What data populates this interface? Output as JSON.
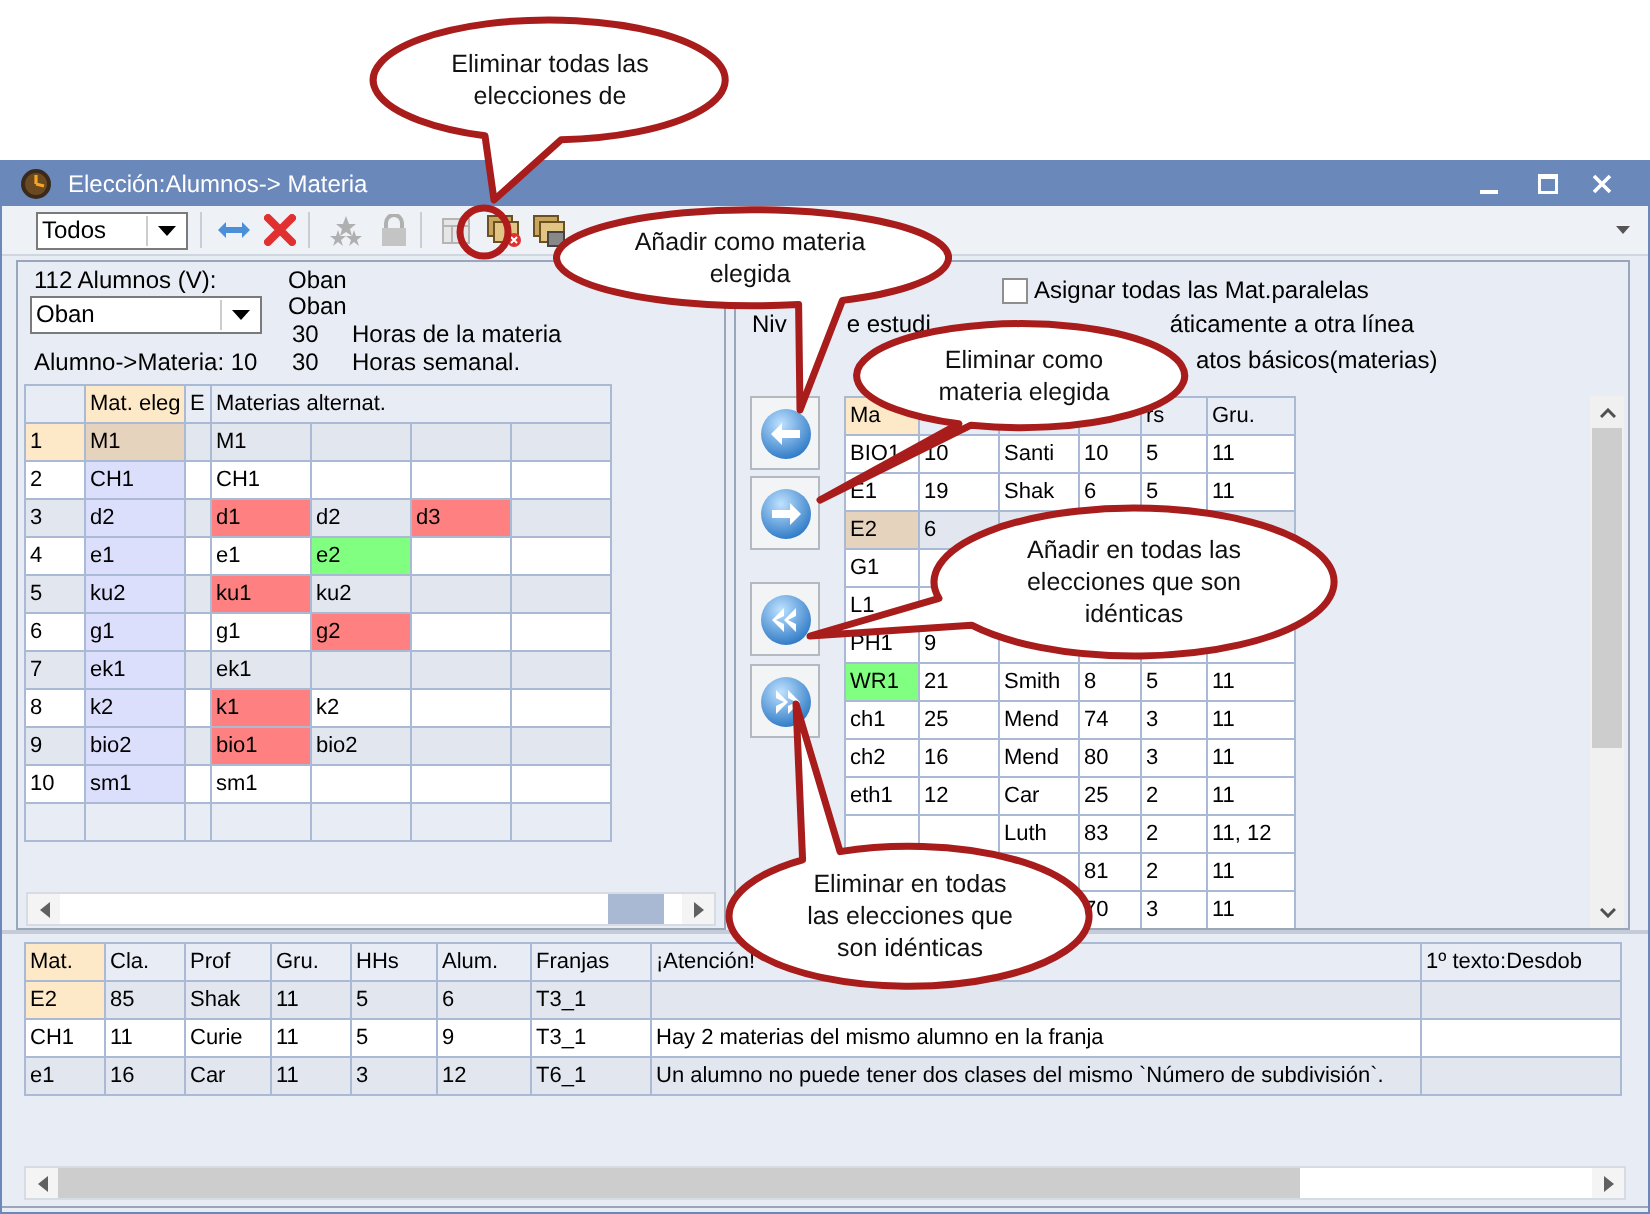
{
  "callouts": [
    {
      "text": "Eliminar todas las elecciones de"
    },
    {
      "text": "Añadir como materia elegida"
    },
    {
      "text": "Eliminar como materia elegida"
    },
    {
      "text": "Añadir en todas las elecciones que son idénticas"
    },
    {
      "text": "Eliminar en todas las elecciones que son idénticas"
    }
  ],
  "window": {
    "title": "Elección:Alumnos-> Materia"
  },
  "toolbar": {
    "filter": "Todos"
  },
  "student": {
    "count_label": "112 Alumnos (V):",
    "selected": "Oban",
    "name_1": "Oban",
    "name_2": "Oban",
    "subject_hours": "30",
    "subject_hours_label": "Horas de la materia",
    "assignment_label": "Alumno->Materia: 10",
    "weekly_hours": "30",
    "weekly_hours_label": "Horas semanal."
  },
  "choices": {
    "columns": [
      "Mat. eleg",
      "E",
      "Materias alternat."
    ],
    "rows": [
      {
        "number": "1",
        "selected": true,
        "chosen": "M1",
        "alternatives": [
          {
            "text": "M1"
          }
        ]
      },
      {
        "number": "2",
        "selected": false,
        "chosen": "CH1",
        "alternatives": [
          {
            "text": "CH1"
          }
        ]
      },
      {
        "number": "3",
        "selected": false,
        "chosen": "d2",
        "alternatives": [
          {
            "text": "d1",
            "color": "#ff8080"
          },
          {
            "text": "d2"
          },
          {
            "text": "d3",
            "color": "#ff8080"
          }
        ]
      },
      {
        "number": "4",
        "selected": false,
        "chosen": "e1",
        "alternatives": [
          {
            "text": "e1"
          },
          {
            "text": "e2",
            "color": "#80ff80"
          }
        ]
      },
      {
        "number": "5",
        "selected": false,
        "chosen": "ku2",
        "alternatives": [
          {
            "text": "ku1",
            "color": "#ff8080"
          },
          {
            "text": "ku2"
          }
        ]
      },
      {
        "number": "6",
        "selected": false,
        "chosen": "g1",
        "alternatives": [
          {
            "text": "g1"
          },
          {
            "text": "g2",
            "color": "#ff8080"
          }
        ]
      },
      {
        "number": "7",
        "selected": false,
        "chosen": "ek1",
        "alternatives": [
          {
            "text": "ek1"
          }
        ]
      },
      {
        "number": "8",
        "selected": false,
        "chosen": "k2",
        "alternatives": [
          {
            "text": "k1",
            "color": "#ff8080"
          },
          {
            "text": "k2"
          }
        ]
      },
      {
        "number": "9",
        "selected": false,
        "chosen": "bio2",
        "alternatives": [
          {
            "text": "bio1",
            "color": "#ff8080"
          },
          {
            "text": "bio2"
          }
        ]
      },
      {
        "number": "10",
        "selected": false,
        "chosen": "sm1",
        "alternatives": [
          {
            "text": "sm1"
          }
        ]
      }
    ]
  },
  "options": {
    "checkbox": {
      "label": "Asignar todas las Mat.paralelas",
      "checked": false
    },
    "partial_texts": [
      "Niv",
      "e estudi",
      "áticamente a otra línea",
      "atos básicos(materias)"
    ]
  },
  "subjects": {
    "columns": [
      "Ma",
      null,
      null,
      null,
      "rs",
      "Gru."
    ],
    "rows": [
      {
        "selected": false,
        "cells": [
          "BIO1",
          "10",
          "Santi",
          "10",
          "5",
          "11"
        ]
      },
      {
        "selected": false,
        "cells": [
          "E1",
          "19",
          "Shak",
          "6",
          "5",
          "11"
        ]
      },
      {
        "selected": true,
        "cells": [
          "E2",
          "6",
          null,
          null,
          null,
          null
        ]
      },
      {
        "selected": false,
        "cells": [
          "G1",
          null,
          null,
          null,
          null,
          null
        ]
      },
      {
        "selected": false,
        "cells": [
          "L1",
          null,
          null,
          null,
          null,
          null
        ]
      },
      {
        "selected": false,
        "cells": [
          "PH1",
          "9",
          null,
          null,
          null,
          null
        ]
      },
      {
        "selected": false,
        "color": "#80ff80",
        "cells": [
          "WR1",
          "21",
          "Smith",
          "8",
          "5",
          "11"
        ]
      },
      {
        "selected": false,
        "cells": [
          "ch1",
          "25",
          "Mend",
          "74",
          "3",
          "11"
        ]
      },
      {
        "selected": false,
        "cells": [
          "ch2",
          "16",
          "Mend",
          "80",
          "3",
          "11"
        ]
      },
      {
        "selected": false,
        "cells": [
          "eth1",
          "12",
          "Car",
          "25",
          "2",
          "11"
        ]
      },
      {
        "selected": false,
        "cells": [
          null,
          null,
          "Luth",
          "83",
          "2",
          "11, 12"
        ]
      },
      {
        "selected": false,
        "cells": [
          null,
          null,
          null,
          "81",
          "2",
          "11"
        ]
      },
      {
        "selected": false,
        "cells": [
          null,
          null,
          null,
          "70",
          "3",
          "11"
        ]
      }
    ]
  },
  "conflicts": {
    "columns": [
      "Mat.",
      "Cla.",
      "Prof",
      "Gru.",
      "HHs",
      "Alum.",
      "Franjas",
      "¡Atención!",
      "1º texto:Desdob"
    ],
    "rows": [
      {
        "selected": true,
        "cells": [
          "E2",
          "85",
          "Shak",
          "11",
          "5",
          "6",
          "T3_1",
          null,
          null
        ]
      },
      {
        "selected": false,
        "cells": [
          "CH1",
          "11",
          "Curie",
          "11",
          "5",
          "9",
          "T3_1",
          "Hay 2 materias del mismo alumno en la franja",
          null
        ]
      },
      {
        "selected": false,
        "cells": [
          "e1",
          "16",
          "Car",
          "11",
          "3",
          "12",
          "T6_1",
          "Un alumno no puede tener dos clases del mismo `Número de subdivisión`.",
          null
        ]
      }
    ]
  }
}
